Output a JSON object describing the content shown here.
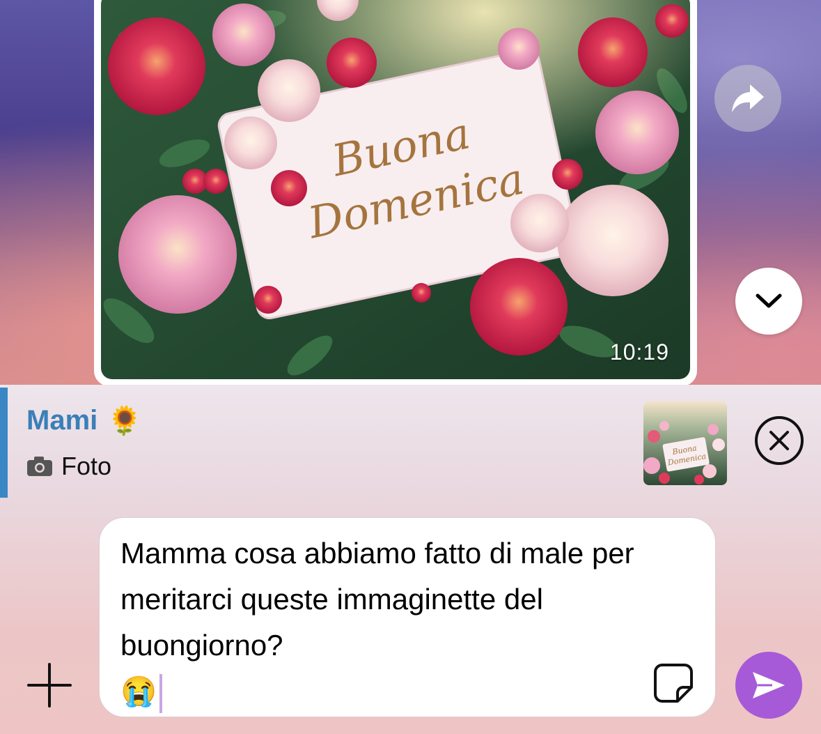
{
  "message": {
    "image_text_line1": "Buona",
    "image_text_line2": "Domenica",
    "time": "10:19"
  },
  "reply": {
    "sender": "Mami",
    "sender_emoji": "🌻",
    "type_label": "Foto",
    "thumb_text_line1": "Buona",
    "thumb_text_line2": "Domenica"
  },
  "composer": {
    "text": "Mamma cosa abbiamo fatto di male per meritarci queste immaginette del buongiorno?",
    "emoji": "😭"
  },
  "icons": {
    "forward": "forward-arrow-icon",
    "scroll_down": "chevron-down-icon",
    "cancel": "close-circle-icon",
    "attach": "plus-icon",
    "sticker": "sticker-icon",
    "send": "send-icon",
    "camera": "camera-icon"
  },
  "colors": {
    "accent": "#3b86c4",
    "send": "#a65ad8"
  }
}
